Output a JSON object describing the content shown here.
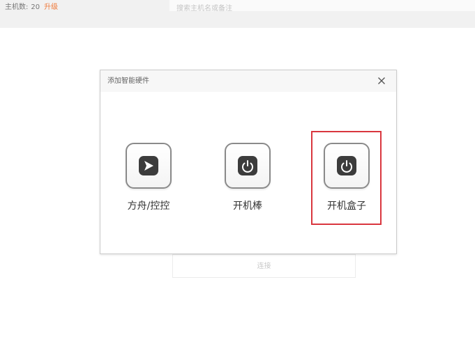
{
  "background": {
    "host_count_label": "主机数:",
    "host_count_value": "20",
    "upgrade_label": "升级",
    "search_placeholder": "搜索主机名或备注",
    "connect_button_label": "连接"
  },
  "dialog": {
    "title": "添加智能硬件",
    "close_icon": "close-icon",
    "options": [
      {
        "label": "方舟/控控",
        "icon": "ark-play-icon"
      },
      {
        "label": "开机棒",
        "icon": "power-icon"
      },
      {
        "label": "开机盒子",
        "icon": "power-icon",
        "selected": true
      }
    ],
    "highlight_color": "#d9363e"
  },
  "colors": {
    "accent": "#f07a3a",
    "icon_dark": "#3c3c3c"
  }
}
